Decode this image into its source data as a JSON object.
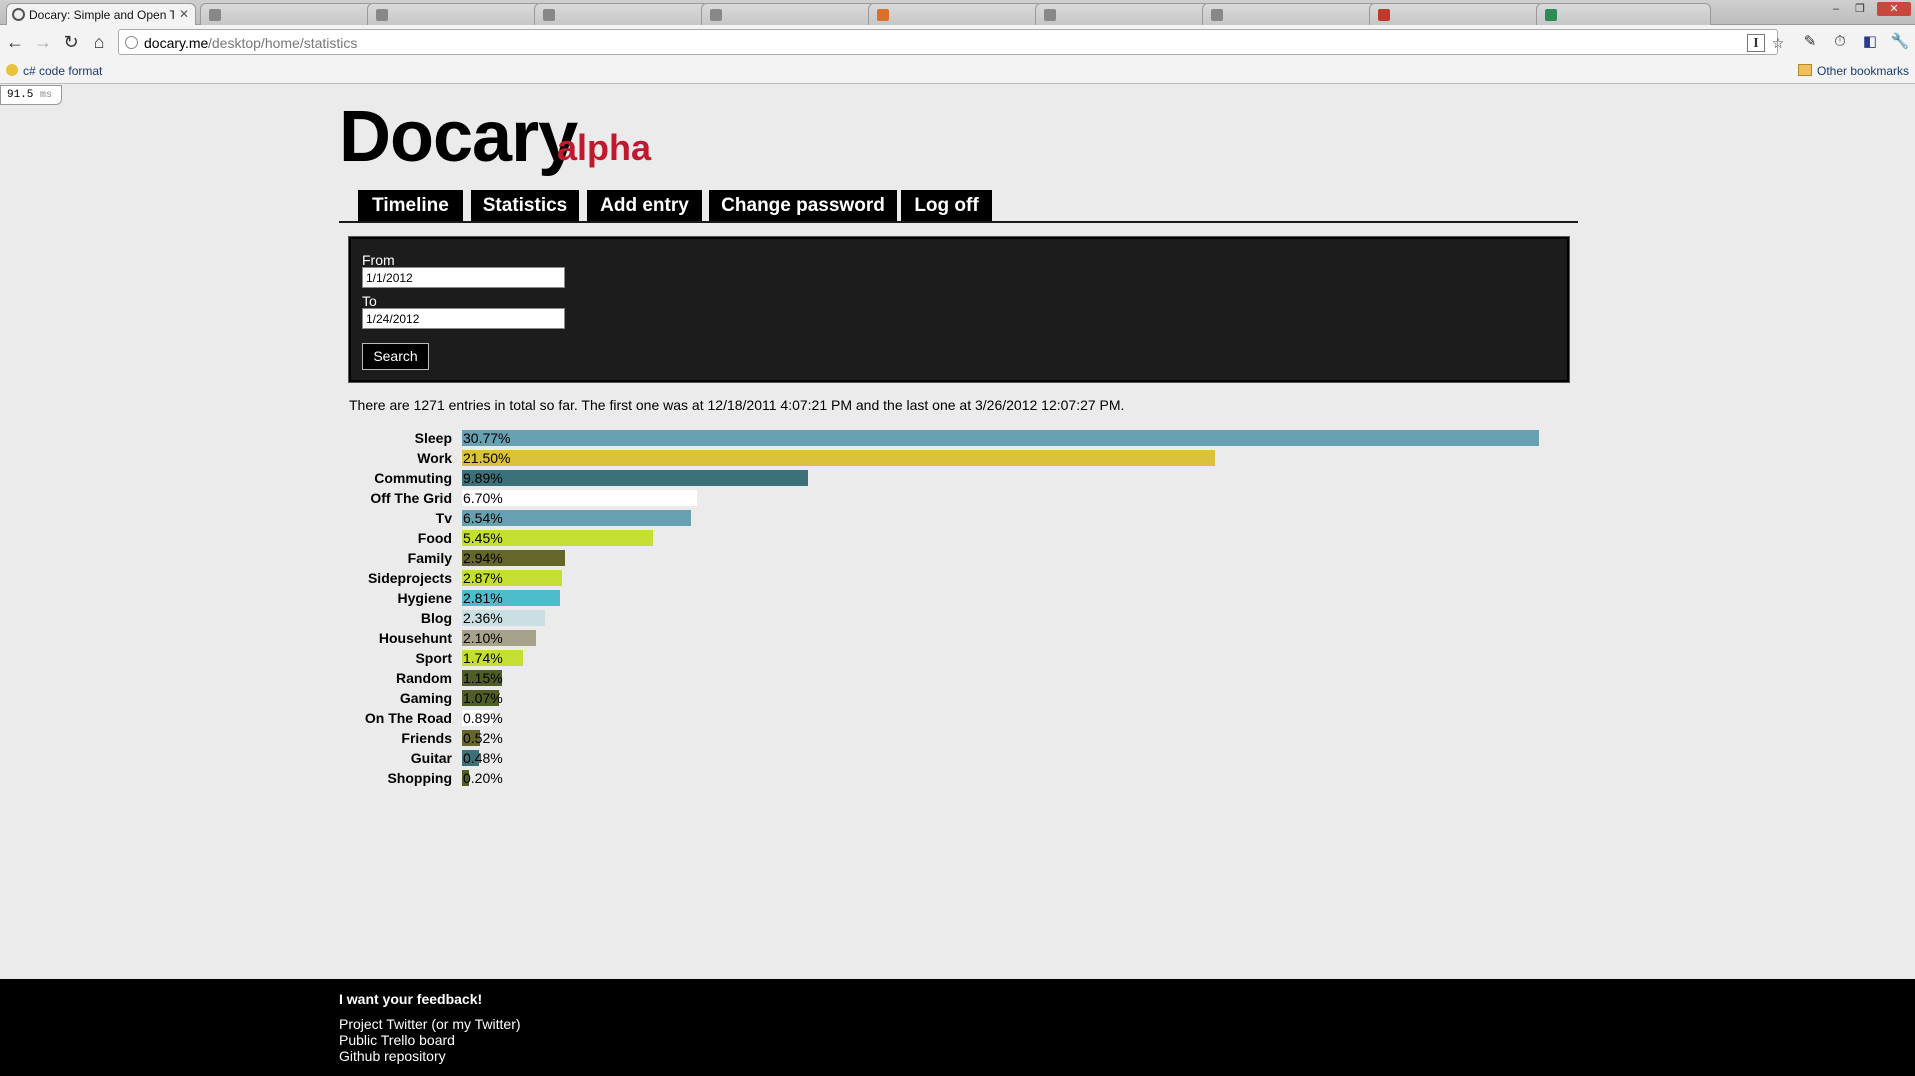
{
  "browser": {
    "active_tab_title": "Docary: Simple and Open T",
    "url_host": "docary.me",
    "url_path": "/desktop/home/statistics",
    "bookmarks": {
      "left_label": "c# code format",
      "right_label": "Other bookmarks"
    },
    "timing": {
      "value": "91.5",
      "unit": "ms"
    }
  },
  "header": {
    "logo": "Docary",
    "logo_suffix": "alpha"
  },
  "nav": {
    "items": [
      "Timeline",
      "Statistics",
      "Add entry",
      "Change password",
      "Log off"
    ]
  },
  "search": {
    "from_label": "From",
    "from_value": "1/1/2012",
    "to_label": "To",
    "to_value": "1/24/2012",
    "button_label": "Search"
  },
  "summary": "There are 1271 entries in total so far. The first one was at 12/18/2011 4:07:21 PM and the last one at 3/26/2012 12:07:27 PM.",
  "stats": [
    {
      "label": "Sleep",
      "value": "30.77%",
      "percent": 30.77,
      "color": "#67a0b0"
    },
    {
      "label": "Work",
      "value": "21.50%",
      "percent": 21.5,
      "color": "#dcc23a"
    },
    {
      "label": "Commuting",
      "value": "9.89%",
      "percent": 9.89,
      "color": "#3c7179"
    },
    {
      "label": "Off The Grid",
      "value": "6.70%",
      "percent": 6.7,
      "color": "#ffffff"
    },
    {
      "label": "Tv",
      "value": "6.54%",
      "percent": 6.54,
      "color": "#67a0b0"
    },
    {
      "label": "Food",
      "value": "5.45%",
      "percent": 5.45,
      "color": "#c5de33"
    },
    {
      "label": "Family",
      "value": "2.94%",
      "percent": 2.94,
      "color": "#65672a"
    },
    {
      "label": "Sideprojects",
      "value": "2.87%",
      "percent": 2.87,
      "color": "#c5de33"
    },
    {
      "label": "Hygiene",
      "value": "2.81%",
      "percent": 2.81,
      "color": "#4fbccc"
    },
    {
      "label": "Blog",
      "value": "2.36%",
      "percent": 2.36,
      "color": "#c9dfe2"
    },
    {
      "label": "Househunt",
      "value": "2.10%",
      "percent": 2.1,
      "color": "#a7a38a"
    },
    {
      "label": "Sport",
      "value": "1.74%",
      "percent": 1.74,
      "color": "#c5de33"
    },
    {
      "label": "Random",
      "value": "1.15%",
      "percent": 1.15,
      "color": "#4f5e26"
    },
    {
      "label": "Gaming",
      "value": "1.07%",
      "percent": 1.07,
      "color": "#4f5e26"
    },
    {
      "label": "On The Road",
      "value": "0.89%",
      "percent": 0.89,
      "color": "#ffffff"
    },
    {
      "label": "Friends",
      "value": "0.52%",
      "percent": 0.52,
      "color": "#65672a"
    },
    {
      "label": "Guitar",
      "value": "0.48%",
      "percent": 0.48,
      "color": "#3c7179"
    },
    {
      "label": "Shopping",
      "value": "0.20%",
      "percent": 0.2,
      "color": "#4f5e26"
    }
  ],
  "footer": {
    "heading": "I want your feedback!",
    "links": [
      "Project Twitter (or my Twitter)",
      "Public Trello board",
      "Github repository"
    ]
  }
}
